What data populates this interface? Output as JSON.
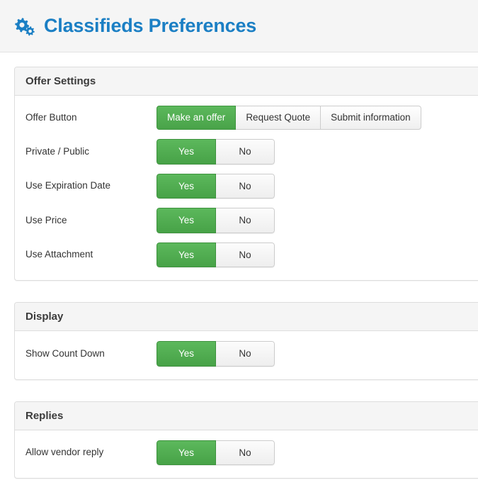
{
  "header": {
    "icon": "gears-icon",
    "title": "Classifieds Preferences",
    "title_color": "#1b7fc4"
  },
  "theme": {
    "active_green": "#5cb85c",
    "panel_border": "#dddddd",
    "panel_heading_bg": "#f5f5f5",
    "text_color": "#333333"
  },
  "panels": [
    {
      "title": "Offer Settings",
      "rows": [
        {
          "label": "Offer Button",
          "control": "segmented",
          "options": [
            "Make an offer",
            "Request Quote",
            "Submit information"
          ],
          "selected": "Make an offer"
        },
        {
          "label": "Private / Public",
          "control": "toggle",
          "options": [
            "Yes",
            "No"
          ],
          "selected": "Yes"
        },
        {
          "label": "Use Expiration Date",
          "control": "toggle",
          "options": [
            "Yes",
            "No"
          ],
          "selected": "Yes"
        },
        {
          "label": "Use Price",
          "control": "toggle",
          "options": [
            "Yes",
            "No"
          ],
          "selected": "Yes"
        },
        {
          "label": "Use Attachment",
          "control": "toggle",
          "options": [
            "Yes",
            "No"
          ],
          "selected": "Yes"
        }
      ]
    },
    {
      "title": "Display",
      "rows": [
        {
          "label": "Show Count Down",
          "control": "toggle",
          "options": [
            "Yes",
            "No"
          ],
          "selected": "Yes"
        }
      ]
    },
    {
      "title": "Replies",
      "rows": [
        {
          "label": "Allow vendor reply",
          "control": "toggle",
          "options": [
            "Yes",
            "No"
          ],
          "selected": "Yes"
        }
      ]
    }
  ]
}
